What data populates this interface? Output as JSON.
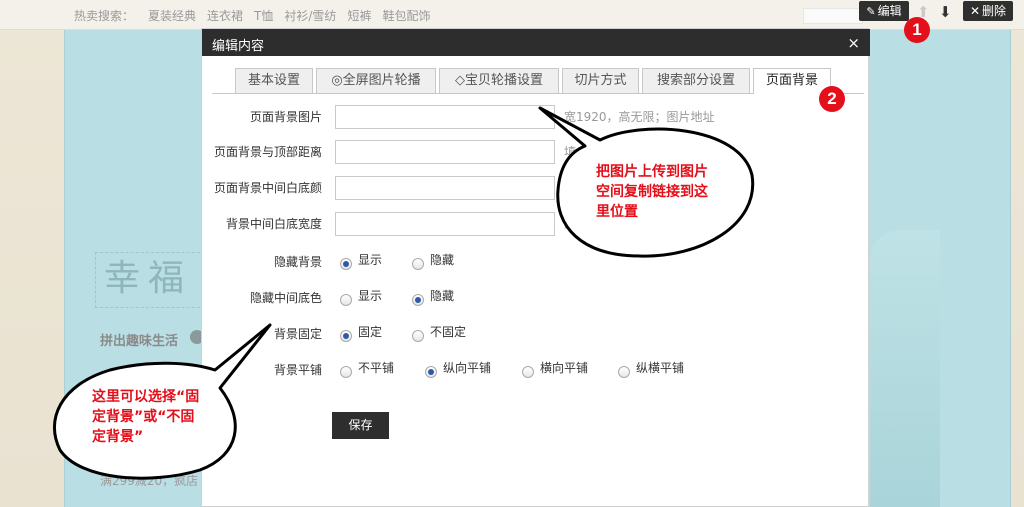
{
  "background": {
    "hot_label": "热卖搜索：",
    "hot_links": [
      "夏装经典",
      "连衣裙",
      "T恤",
      "衬衫/雪纺",
      "短裤",
      "鞋包配饰"
    ],
    "hero_title": "幸福",
    "slogan": "拼出趣味生活",
    "promo": "满299减20，疯店"
  },
  "toolbar": {
    "edit_label": "编辑",
    "delete_label": "删除"
  },
  "badges": [
    "1",
    "2"
  ],
  "dialog": {
    "title": "编辑内容",
    "close": "×",
    "tabs": [
      "基本设置",
      "◎全屏图片轮播",
      "◇宝贝轮播设置",
      "切片方式",
      "搜索部分设置",
      "页面背景"
    ],
    "active_tab": "页面背景",
    "fields": [
      {
        "label": "页面背景图片",
        "value": "",
        "hint": "宽1920，高无限；图片地址"
      },
      {
        "label": "页面背景与顶部距离",
        "value": "",
        "hint": "填"
      },
      {
        "label": "页面背景中间白底颜",
        "value": "",
        "hint": ""
      },
      {
        "label": "背景中间白底宽度",
        "value": "",
        "hint": "默"
      }
    ],
    "radio_groups": [
      {
        "label": "隐藏背景",
        "options": [
          "显示",
          "隐藏"
        ],
        "selected": "显示"
      },
      {
        "label": "隐藏中间底色",
        "options": [
          "显示",
          "隐藏"
        ],
        "selected": "隐藏"
      },
      {
        "label": "背景固定",
        "options": [
          "固定",
          "不固定"
        ],
        "selected": "固定"
      },
      {
        "label": "背景平铺",
        "options": [
          "不平铺",
          "纵向平铺",
          "横向平铺",
          "纵横平铺"
        ],
        "selected": "纵向平铺"
      }
    ],
    "save_label": "保存"
  },
  "callouts": {
    "upload": [
      "把图片上传到图片",
      "空间复制链接到这",
      "里位置"
    ],
    "fixed": [
      "这里可以选择“固",
      "定背景”或“不固",
      "定背景”"
    ]
  },
  "colors": {
    "accent_red": "#e30f1a",
    "dark": "#2d2d2d",
    "radio_dot": "#2b5aa7"
  }
}
